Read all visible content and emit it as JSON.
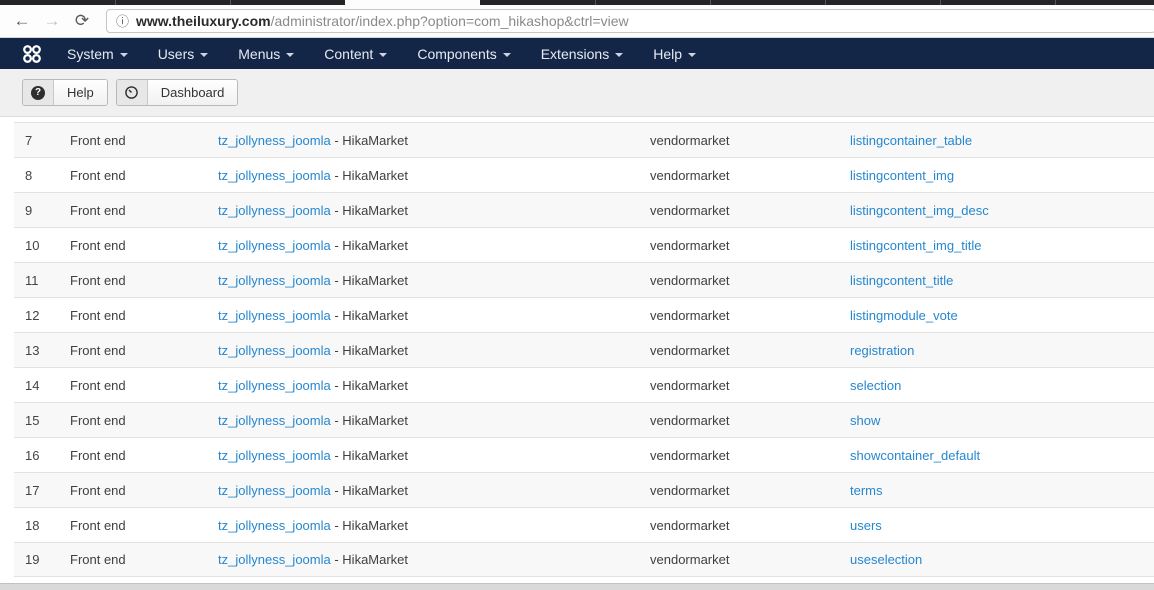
{
  "browser": {
    "url": {
      "host": "www.theiluxury.com",
      "path": "/administrator/index.php?option=com_hikashop&ctrl=view"
    },
    "icons": {
      "back": "←",
      "forward": "→",
      "reload": "⟳",
      "info": "ⓘ"
    }
  },
  "admin_navbar": {
    "menus": [
      {
        "label": "System"
      },
      {
        "label": "Users"
      },
      {
        "label": "Menus"
      },
      {
        "label": "Content"
      },
      {
        "label": "Components"
      },
      {
        "label": "Extensions"
      },
      {
        "label": "Help"
      }
    ]
  },
  "toolbar": {
    "buttons": [
      {
        "label": "Help",
        "icon": "?"
      },
      {
        "label": "Dashboard",
        "icon": "gauge"
      }
    ]
  },
  "table": {
    "rows": [
      {
        "num": "7",
        "type": "Front end",
        "template_link": "tz_jollyness_joomla",
        "template_suffix": " - HikaMarket",
        "menu": "vendormarket",
        "file": "listingcontainer_table"
      },
      {
        "num": "8",
        "type": "Front end",
        "template_link": "tz_jollyness_joomla",
        "template_suffix": " - HikaMarket",
        "menu": "vendormarket",
        "file": "listingcontent_img"
      },
      {
        "num": "9",
        "type": "Front end",
        "template_link": "tz_jollyness_joomla",
        "template_suffix": " - HikaMarket",
        "menu": "vendormarket",
        "file": "listingcontent_img_desc"
      },
      {
        "num": "10",
        "type": "Front end",
        "template_link": "tz_jollyness_joomla",
        "template_suffix": " - HikaMarket",
        "menu": "vendormarket",
        "file": "listingcontent_img_title"
      },
      {
        "num": "11",
        "type": "Front end",
        "template_link": "tz_jollyness_joomla",
        "template_suffix": " - HikaMarket",
        "menu": "vendormarket",
        "file": "listingcontent_title"
      },
      {
        "num": "12",
        "type": "Front end",
        "template_link": "tz_jollyness_joomla",
        "template_suffix": " - HikaMarket",
        "menu": "vendormarket",
        "file": "listingmodule_vote"
      },
      {
        "num": "13",
        "type": "Front end",
        "template_link": "tz_jollyness_joomla",
        "template_suffix": " - HikaMarket",
        "menu": "vendormarket",
        "file": "registration"
      },
      {
        "num": "14",
        "type": "Front end",
        "template_link": "tz_jollyness_joomla",
        "template_suffix": " - HikaMarket",
        "menu": "vendormarket",
        "file": "selection"
      },
      {
        "num": "15",
        "type": "Front end",
        "template_link": "tz_jollyness_joomla",
        "template_suffix": " - HikaMarket",
        "menu": "vendormarket",
        "file": "show"
      },
      {
        "num": "16",
        "type": "Front end",
        "template_link": "tz_jollyness_joomla",
        "template_suffix": " - HikaMarket",
        "menu": "vendormarket",
        "file": "showcontainer_default"
      },
      {
        "num": "17",
        "type": "Front end",
        "template_link": "tz_jollyness_joomla",
        "template_suffix": " - HikaMarket",
        "menu": "vendormarket",
        "file": "terms"
      },
      {
        "num": "18",
        "type": "Front end",
        "template_link": "tz_jollyness_joomla",
        "template_suffix": " - HikaMarket",
        "menu": "vendormarket",
        "file": "users"
      },
      {
        "num": "19",
        "type": "Front end",
        "template_link": "tz_jollyness_joomla",
        "template_suffix": " - HikaMarket",
        "menu": "vendormarket",
        "file": "useselection"
      }
    ]
  },
  "colors": {
    "link": "#2687ce",
    "admin_navbar_bg": "#132648",
    "toolbar_bg": "#f0f0f0",
    "row_stripe": "#f8f8f8",
    "row_border": "#e3e3e3"
  }
}
